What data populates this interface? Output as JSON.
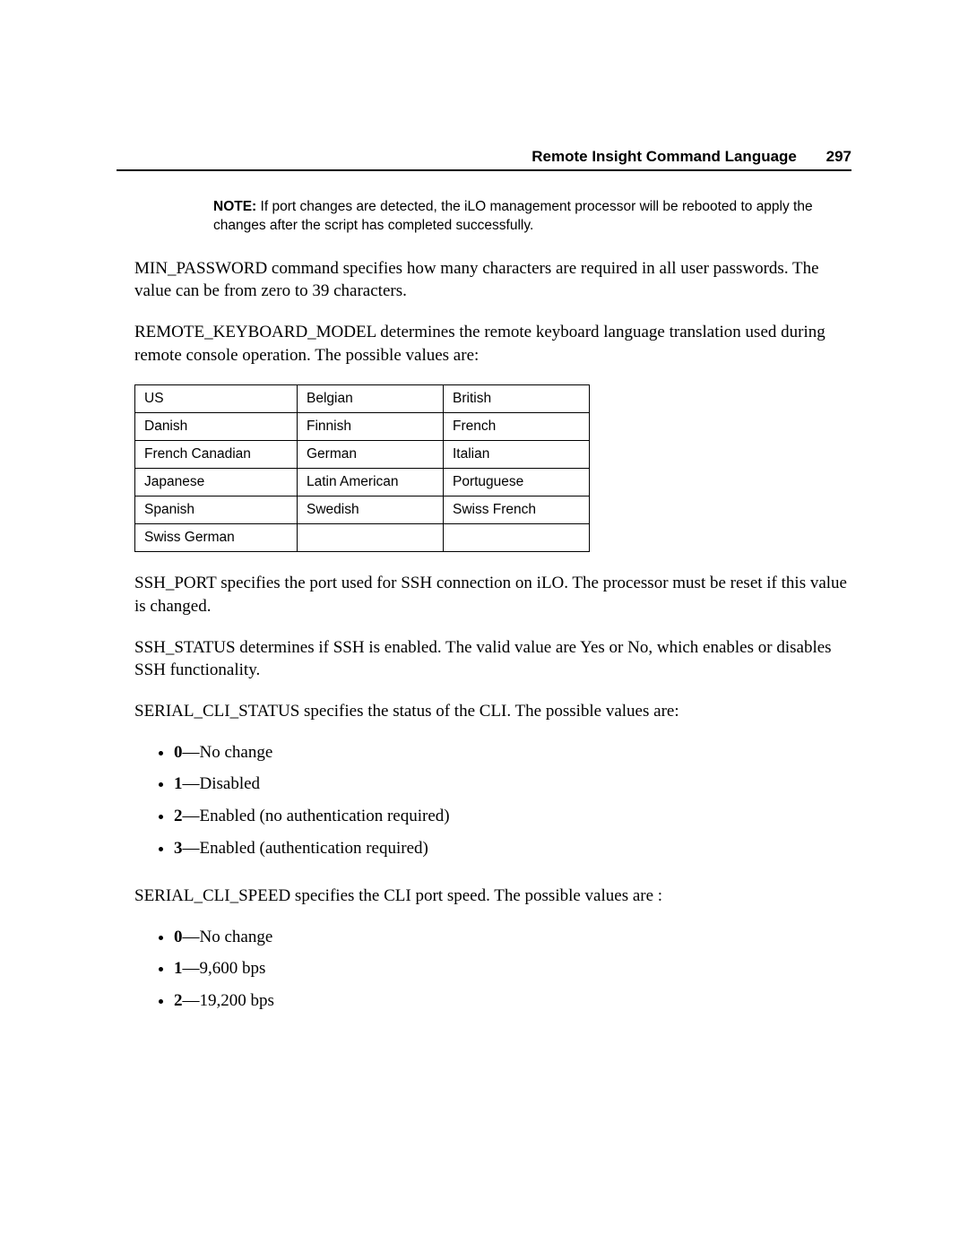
{
  "header": {
    "title": "Remote Insight Command Language",
    "page_number": "297"
  },
  "note": {
    "label": "NOTE:",
    "text": "If port changes are detected, the iLO management processor will be rebooted to apply the changes after the script has completed successfully."
  },
  "para_min_password": "MIN_PASSWORD command specifies how many characters are required in all user passwords. The value can be from zero to 39 characters.",
  "para_remote_keyboard": "REMOTE_KEYBOARD_MODEL determines the remote keyboard language translation used during remote console operation.  The possible values are:",
  "table_rows": [
    [
      "US",
      "Belgian",
      "British"
    ],
    [
      "Danish",
      "Finnish",
      "French"
    ],
    [
      "French Canadian",
      "German",
      "Italian"
    ],
    [
      "Japanese",
      "Latin American",
      "Portuguese"
    ],
    [
      "Spanish",
      "Swedish",
      "Swiss French"
    ],
    [
      "Swiss German",
      "",
      ""
    ]
  ],
  "para_ssh_port": "SSH_PORT specifies the port used for SSH connection on iLO. The processor must be reset if this value is changed.",
  "para_ssh_status": "SSH_STATUS determines if SSH is enabled. The valid value are Yes or No, which enables or disables SSH functionality.",
  "para_serial_cli_status": "SERIAL_CLI_STATUS specifies the status of the CLI. The possible values are:",
  "cli_status_items": [
    {
      "code": "0",
      "desc": "—No change"
    },
    {
      "code": "1",
      "desc": "—Disabled"
    },
    {
      "code": "2",
      "desc": "—Enabled (no authentication required)"
    },
    {
      "code": "3",
      "desc": "—Enabled (authentication required)"
    }
  ],
  "para_serial_cli_speed": "SERIAL_CLI_SPEED specifies the CLI port speed. The possible values are :",
  "cli_speed_items": [
    {
      "code": "0",
      "desc": "—No change"
    },
    {
      "code": "1",
      "desc": "—9,600 bps"
    },
    {
      "code": "2",
      "desc": "—19,200 bps"
    }
  ]
}
